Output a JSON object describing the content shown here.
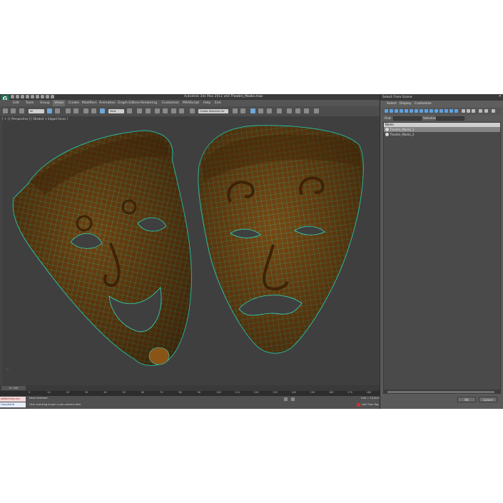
{
  "window": {
    "app_title": "Autodesk 3ds Max  2012 x64",
    "file_name": "Theatre_Masks.max",
    "icon_letter": "G"
  },
  "menu": [
    "Edit",
    "Tools",
    "Group",
    "Views",
    "Create",
    "Modifiers",
    "Animation",
    "Graph Editors",
    "Rendering",
    "Customize",
    "MAXScript",
    "Help",
    "Exit"
  ],
  "toolbar": {
    "filter_dropdown": "All",
    "coord_dropdown": "View",
    "selection_set_dropdown": "Create Selection Se"
  },
  "viewport": {
    "label": "[ + ] [ Perspective ] [ Shaded + Edged Faces ]",
    "object": "Theatre_Masks",
    "colors": {
      "wood": "#7a4a12",
      "wood_dark": "#3e2206",
      "wire": "#2fd6b8",
      "background": "#3f3f3f"
    }
  },
  "timeline": {
    "slider": "0 / 100",
    "ticks": [
      "0",
      "10",
      "20",
      "30",
      "40",
      "50",
      "60",
      "70",
      "80",
      "90",
      "100",
      "110",
      "120",
      "130",
      "140",
      "150",
      "160",
      "170",
      "180"
    ]
  },
  "status": {
    "maxscript_text": "weltlichhen.ms",
    "script_text": "ClassAttrib",
    "selection": "None Selected",
    "prompt": "Click and drag to pan a non-camera view",
    "grid": "Grid = 10,0cm",
    "add_time_tag": "Add Time Tag"
  },
  "dialog": {
    "title": "Select From Scene",
    "close": "✕",
    "menu": [
      "Select",
      "Display",
      "Customize"
    ],
    "find_label": "Find:",
    "find_value": "",
    "selection_set_label": "Selection Set:",
    "selection_set_value": "",
    "column_header": "Name",
    "items": [
      "Theatre_Masks_1",
      "Theatre_Masks_2"
    ],
    "selected_index": 0,
    "ok": "OK",
    "cancel": "Cancel"
  }
}
